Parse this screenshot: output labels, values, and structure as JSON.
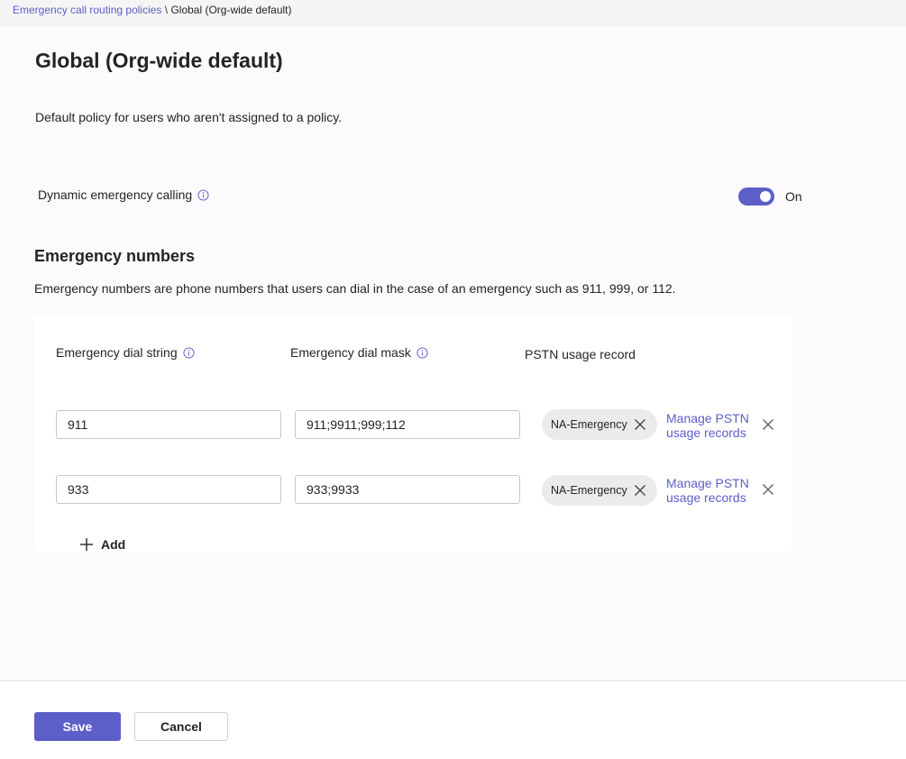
{
  "breadcrumb": {
    "parent": "Emergency call routing policies",
    "separator": "\\",
    "current": "Global (Org-wide default)"
  },
  "page": {
    "title": "Global (Org-wide default)",
    "description": "Default policy for users who aren't assigned to a policy."
  },
  "dynamic_calling": {
    "label": "Dynamic emergency calling",
    "state_label": "On",
    "enabled": true
  },
  "emergency_numbers": {
    "title": "Emergency numbers",
    "description": "Emergency numbers are phone numbers that users can dial in the case of an emergency such as 911, 999, or 112.",
    "columns": {
      "dial_string": "Emergency dial string",
      "dial_mask": "Emergency dial mask",
      "pstn": "PSTN usage record"
    },
    "rows": [
      {
        "dial_string": "911",
        "dial_mask": "911;9911;999;112",
        "pstn_chip": "NA-Emergency",
        "manage_link": "Manage PSTN usage records"
      },
      {
        "dial_string": "933",
        "dial_mask": "933;9933",
        "pstn_chip": "NA-Emergency",
        "manage_link": "Manage PSTN usage records"
      }
    ],
    "add_label": "Add"
  },
  "footer": {
    "save_label": "Save",
    "cancel_label": "Cancel"
  },
  "colors": {
    "accent": "#5b5fc7",
    "content_bg": "#fdfafd",
    "chip_bg": "#ebebeb"
  },
  "icons": {
    "info": "info-icon",
    "dismiss": "close-icon",
    "add": "plus-icon"
  }
}
